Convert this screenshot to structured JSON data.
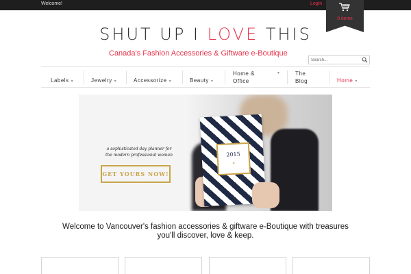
{
  "topbar": {
    "welcome": "Welcome!",
    "login": "Login"
  },
  "cart": {
    "icon": "cart-icon",
    "count": "0 items"
  },
  "logo": {
    "left": "SHUT UP I ",
    "middle": "LOVE",
    "right": " THIS"
  },
  "tagline": "Canada's Fashion Accessories & Giftware e-Boutique",
  "search": {
    "placeholder": "Search...",
    "icon": "search-icon"
  },
  "nav": {
    "labels": "Labels",
    "jewelry": "Jewelry",
    "accessorize": "Accessorize",
    "beauty": "Beauty",
    "home_office_1": "Home &",
    "home_office_2": "Office",
    "blog_1": "The",
    "blog_2": "Blog",
    "home": "Home"
  },
  "hero": {
    "tagline_1": "a sophisticated day planner for",
    "tagline_2": "the modern professional woman",
    "cta": "GET YOURS NOW!",
    "planner_year": "2015"
  },
  "welcome_message": {
    "line1": "Welcome to Vancouver's fashion accessories & giftware e-Boutique with treasures",
    "line2": "you'll discover, love & keep."
  },
  "colors": {
    "accent": "#e8334a",
    "gold": "#c9a44a",
    "navy": "#1f2a44",
    "dark_bar": "#1e1e1e"
  }
}
